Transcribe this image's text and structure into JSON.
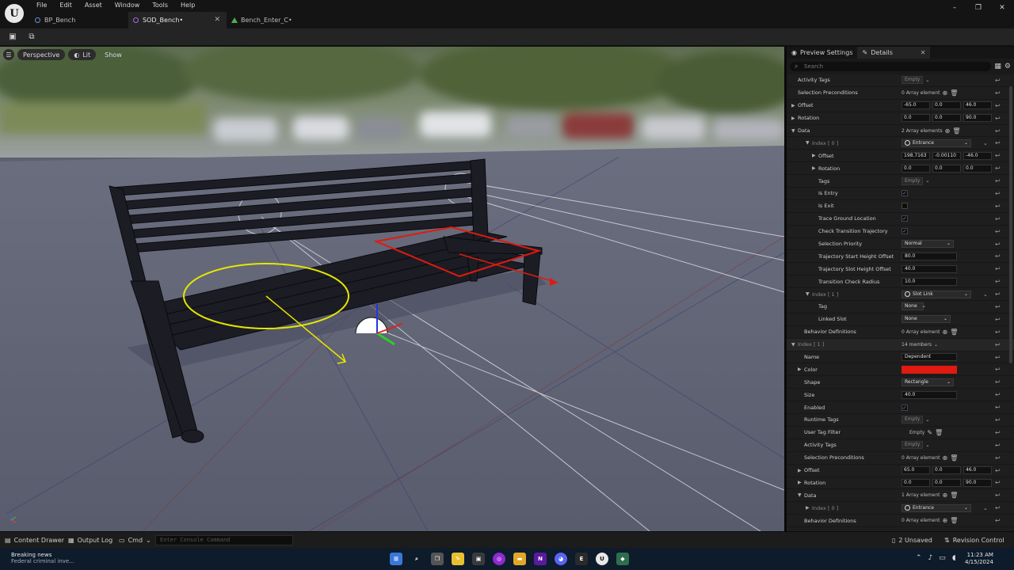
{
  "menu": [
    "File",
    "Edit",
    "Asset",
    "Window",
    "Tools",
    "Help"
  ],
  "tabs": [
    {
      "label": "BP_Bench",
      "active": false
    },
    {
      "label": "SOD_Bench•",
      "active": true
    },
    {
      "label": "Bench_Enter_C•",
      "active": false
    }
  ],
  "window_controls": {
    "minimize": "–",
    "maximize": "❐",
    "close": "✕"
  },
  "viewport": {
    "perspective": "Perspective",
    "lit": "Lit",
    "show": "Show"
  },
  "panel": {
    "tab_preview": "Preview Settings",
    "tab_details": "Details",
    "search_placeholder": "Search"
  },
  "rows": [
    {
      "label": "Activity Tags",
      "kind": "tags",
      "value": "Empty",
      "indent": 14
    },
    {
      "label": "Selection Preconditions",
      "kind": "array",
      "value": "0 Array element",
      "indent": 14
    },
    {
      "label": "Offset",
      "kind": "vec",
      "values": [
        "-65.0",
        "0.0",
        "46.0"
      ],
      "indent": 14,
      "arrow": "▶"
    },
    {
      "label": "Rotation",
      "kind": "vec",
      "values": [
        "0.0",
        "0.0",
        "90.0"
      ],
      "indent": 14,
      "arrow": "▶"
    },
    {
      "label": "Data",
      "kind": "array",
      "value": "2 Array elements",
      "indent": 14,
      "arrow": "▼"
    },
    {
      "label": "Index [ 0 ]",
      "kind": "dropdown",
      "value": "Entrance",
      "indent": 32,
      "arrow": "▼",
      "dim": true
    },
    {
      "label": "Offset",
      "kind": "vec",
      "values": [
        "198.7163",
        "-0.00110",
        "-46.0"
      ],
      "indent": 40,
      "arrow": "▶"
    },
    {
      "label": "Rotation",
      "kind": "vec",
      "values": [
        "0.0",
        "0.0",
        "0.0"
      ],
      "indent": 40,
      "arrow": "▶"
    },
    {
      "label": "Tags",
      "kind": "tags",
      "value": "Empty",
      "indent": 40
    },
    {
      "label": "Is Entry",
      "kind": "check",
      "checked": true,
      "indent": 40
    },
    {
      "label": "Is Exit",
      "kind": "check",
      "checked": false,
      "indent": 40
    },
    {
      "label": "Trace Ground Location",
      "kind": "check",
      "checked": true,
      "indent": 40
    },
    {
      "label": "Check Transition Trajectory",
      "kind": "check",
      "checked": true,
      "indent": 40
    },
    {
      "label": "Selection Priority",
      "kind": "select",
      "value": "Normal",
      "indent": 40
    },
    {
      "label": "Trajectory Start Height Offset",
      "kind": "text",
      "value": "80.0",
      "indent": 40
    },
    {
      "label": "Trajectory Slot Height Offset",
      "kind": "text",
      "value": "40.0",
      "indent": 40
    },
    {
      "label": "Transition Check Radius",
      "kind": "text",
      "value": "10.0",
      "indent": 40
    },
    {
      "label": "Index [ 1 ]",
      "kind": "dropdown",
      "value": "Slot Link",
      "indent": 32,
      "arrow": "▼",
      "dim": true
    },
    {
      "label": "Tag",
      "kind": "select",
      "value": "None",
      "indent": 40
    },
    {
      "label": "Linked Slot",
      "kind": "select",
      "value": "None",
      "indent": 40
    },
    {
      "label": "Behavior Definitions",
      "kind": "array",
      "value": "0 Array element",
      "indent": 22
    },
    {
      "label": "Index [ 1 ]",
      "kind": "members",
      "value": "14 members",
      "indent": 14,
      "arrow": "▼",
      "dim": true,
      "hdr": true
    },
    {
      "label": "Name",
      "kind": "text",
      "value": "Dependent",
      "indent": 22
    },
    {
      "label": "Color",
      "kind": "color",
      "value": "#e01a10",
      "indent": 22,
      "arrow": "▶"
    },
    {
      "label": "Shape",
      "kind": "select",
      "value": "Rectangle",
      "indent": 22
    },
    {
      "label": "Size",
      "kind": "text",
      "value": "40.0",
      "indent": 22
    },
    {
      "label": "Enabled",
      "kind": "check",
      "checked": true,
      "indent": 22
    },
    {
      "label": "Runtime Tags",
      "kind": "tags",
      "value": "Empty",
      "indent": 22
    },
    {
      "label": "User Tag Filter",
      "kind": "filter",
      "value": "Empty",
      "indent": 22
    },
    {
      "label": "Activity Tags",
      "kind": "tags",
      "value": "Empty",
      "indent": 22
    },
    {
      "label": "Selection Preconditions",
      "kind": "array",
      "value": "0 Array element",
      "indent": 22
    },
    {
      "label": "Offset",
      "kind": "vec",
      "values": [
        "65.0",
        "0.0",
        "46.0"
      ],
      "indent": 22,
      "arrow": "▶"
    },
    {
      "label": "Rotation",
      "kind": "vec",
      "values": [
        "0.0",
        "0.0",
        "90.0"
      ],
      "indent": 22,
      "arrow": "▶"
    },
    {
      "label": "Data",
      "kind": "array",
      "value": "1 Array element",
      "indent": 22,
      "arrow": "▼"
    },
    {
      "label": "Index [ 0 ]",
      "kind": "dropdown",
      "value": "Entrance",
      "indent": 32,
      "arrow": "▶",
      "dim": true
    },
    {
      "label": "Behavior Definitions",
      "kind": "array",
      "value": "0 Array element",
      "indent": 22
    }
  ],
  "bottombar": {
    "content_drawer": "Content Drawer",
    "output_log": "Output Log",
    "cmd": "Cmd",
    "console_placeholder": "Enter Console Command",
    "unsaved": "2 Unsaved",
    "revision": "Revision Control"
  },
  "taskbar": {
    "news_title": "Breaking news",
    "news_sub": "Federal criminal inve...",
    "time": "11:23 AM",
    "date": "4/15/2024"
  }
}
